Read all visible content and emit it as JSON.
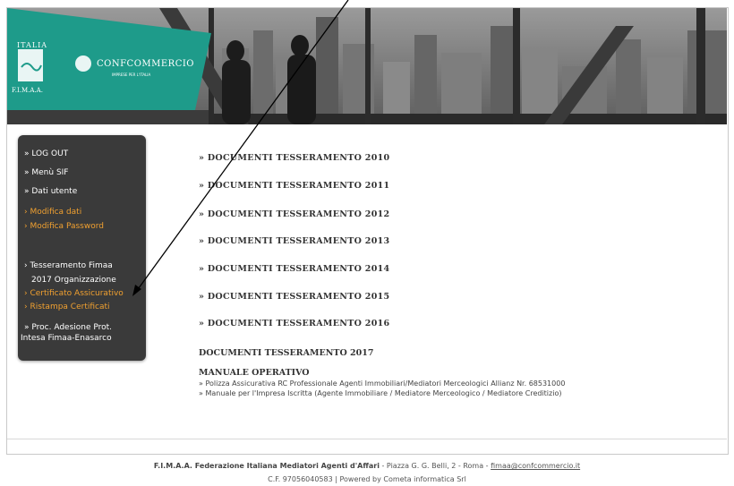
{
  "banner": {
    "logo_italia": "ITALIA",
    "logo_fimaa": "F.I.M.A.A.",
    "logo_confcommercio": "CONFCOMMERCIO",
    "logo_subtitle": "IMPRESE PER L'ITALIA"
  },
  "sidebar": {
    "logout": "» LOG OUT",
    "menu_sif": "» Menù SIF",
    "dati_utente": "» Dati utente",
    "modifica_dati": "› Modifica dati",
    "modifica_password": "› Modifica Password",
    "tesseramento": "› Tesseramento Fimaa",
    "tesseramento_org": "2017 Organizzazione",
    "certificato": "› Certificato Assicurativo",
    "ristampa": "› Ristampa Certificati",
    "proc_line1": "» Proc. Adesione Prot.",
    "proc_line2": "Intesa Fimaa-Enasarco"
  },
  "main": {
    "docs": [
      "» DOCUMENTI TESSERAMENTO 2010",
      "» DOCUMENTI TESSERAMENTO 2011",
      "» DOCUMENTI TESSERAMENTO 2012",
      "» DOCUMENTI TESSERAMENTO 2013",
      "» DOCUMENTI TESSERAMENTO 2014",
      "» DOCUMENTI TESSERAMENTO 2015",
      "» DOCUMENTI TESSERAMENTO 2016"
    ],
    "docs_2017": "DOCUMENTI TESSERAMENTO 2017",
    "manuale_title": "MANUALE OPERATIVO",
    "manuale_items": [
      "» Polizza Assicurativa RC Professionale Agenti Immobiliari/Mediatori Merceologici Allianz Nr. 68531000",
      "» Manuale per l'Impresa Iscritta (Agente Immobiliare / Mediatore Merceologico / Mediatore Creditizio)"
    ]
  },
  "footer": {
    "org_name": "F.I.M.A.A. Federazione Italiana Mediatori Agenti d'Affari",
    "address": " - Piazza G. G. Belli, 2 - Roma - ",
    "email": "fimaa@confcommercio.it",
    "line2": "C.F. 97056040583  |  Powered by Cometa informatica Srl"
  },
  "colors": {
    "sidebar_bg": "#3a3a3a",
    "logo_teal": "#1e9b8a",
    "link_orange": "#f0a030"
  }
}
